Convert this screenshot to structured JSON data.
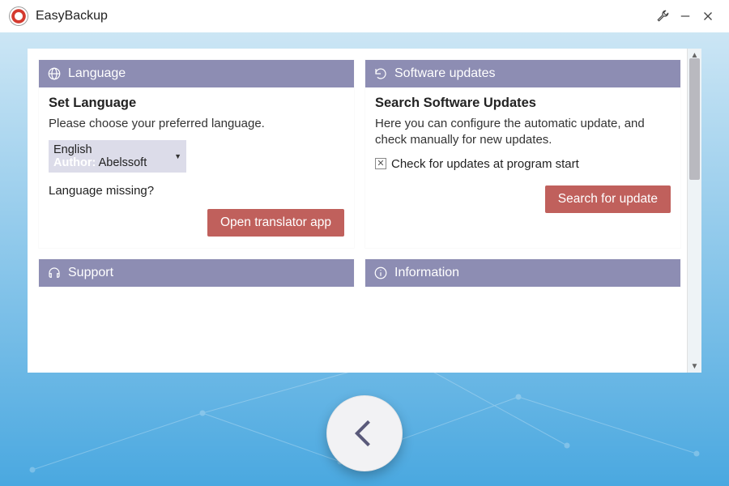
{
  "app": {
    "title": "EasyBackup"
  },
  "titlebar": {
    "settings_icon": "wrench",
    "minimize": "minimize",
    "close": "close"
  },
  "cards": {
    "language": {
      "header": "Language",
      "title": "Set Language",
      "desc": "Please choose your preferred language.",
      "select": {
        "value": "English",
        "author_label": "Author:",
        "author_value": "Abelssoft"
      },
      "missing": "Language missing?",
      "open_translator_btn": "Open translator app"
    },
    "updates": {
      "header": "Software updates",
      "title": "Search Software Updates",
      "desc": "Here you can configure the automatic update, and check manually for new updates.",
      "checkbox_label": "Check for updates at program start",
      "checkbox_checked": true,
      "search_btn": "Search for update"
    },
    "support": {
      "header": "Support"
    },
    "information": {
      "header": "Information"
    }
  },
  "back_button": "back"
}
